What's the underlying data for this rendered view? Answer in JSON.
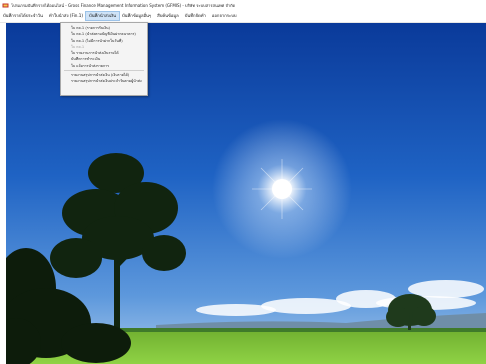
{
  "window": {
    "title": "โปรแกรมบันทึกรายได้ออนไลน์ - Gross Finance Management Information System (GFMIS) - บริษัท ระบบสารสนเทศ จำกัด"
  },
  "menubar": {
    "items": [
      {
        "label": "บันทึกรายได้ประจำวัน"
      },
      {
        "label": "ทำใบนำส่ง (Fin.1)"
      },
      {
        "label": "บันทึกนำส่งเงิน"
      },
      {
        "label": "บันทึกข้อมูลอื่นๆ"
      },
      {
        "label": "สืบค้นข้อมูล"
      },
      {
        "label": "บันทึกจัดทำ"
      },
      {
        "label": "ออกจากระบบ"
      }
    ],
    "active_index": 2
  },
  "dropdown": {
    "items": [
      {
        "label": "ใบ กค.1 (รายการรับเงิน)",
        "disabled": false
      },
      {
        "label": "ใบ กค.1 (นำส่งตามบัญชีเงินฝากธนาคาร)",
        "disabled": false
      },
      {
        "label": "ใบ กค.1 (ไม่มีการนำฝากในวันที่)",
        "disabled": false
      },
      {
        "label": "ใบ กค.1",
        "disabled": true
      },
      {
        "label": "ใบ รายงานการนำส่งเงินรายได้",
        "disabled": false
      },
      {
        "label": "บันทึกการชำระเงิน",
        "disabled": false
      },
      {
        "label": "ใบ แจ้งการนำส่งรายการ",
        "disabled": false
      },
      {
        "label": "รายงานสรุปการนำส่งเงิน (เงินรายได้)",
        "disabled": false
      },
      {
        "label": "รายงานสรุปการนำส่งเงินประจำวันตามผู้นำส่ง",
        "disabled": false
      }
    ],
    "separator_after": [
      6
    ]
  },
  "colors": {
    "sky_top": "#0b3fa0",
    "sky_bottom": "#6fa6e0",
    "grass": "#7fc23a",
    "menu_active": "#cfe3f7"
  },
  "icons": {
    "app_icon": "money-icon"
  }
}
